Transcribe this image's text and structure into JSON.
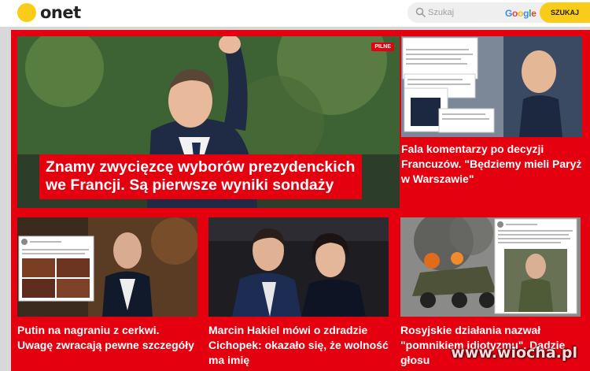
{
  "header": {
    "logo_text": "onet",
    "search_placeholder": "Szukaj",
    "google_label": "Google",
    "search_button": "SZUKAJ"
  },
  "colors": {
    "brand_yellow": "#f9cc19",
    "accent_red": "#e4000f"
  },
  "main": {
    "badge": "PILNE",
    "title": "Znamy zwycięzcę wyborów prezydenckich we Francji. Są pierwsze wyniki sondaży"
  },
  "side": {
    "title": "Fala komentarzy po decyzji Francuzów. \"Będziemy mieli Paryż w Warszawie\""
  },
  "cards": [
    {
      "title": "Putin na nagraniu z cerkwi. Uwagę zwracają pewne szczegóły"
    },
    {
      "title": "Marcin Hakiel mówi o zdradzie Cichopek: okazało się, że wolność ma imię"
    },
    {
      "title": "Rosyjskie działania nazwał \"pomnikiem idiotyzmu\". Dadzie głosu"
    }
  ],
  "watermark": "www.wiocha.pl"
}
